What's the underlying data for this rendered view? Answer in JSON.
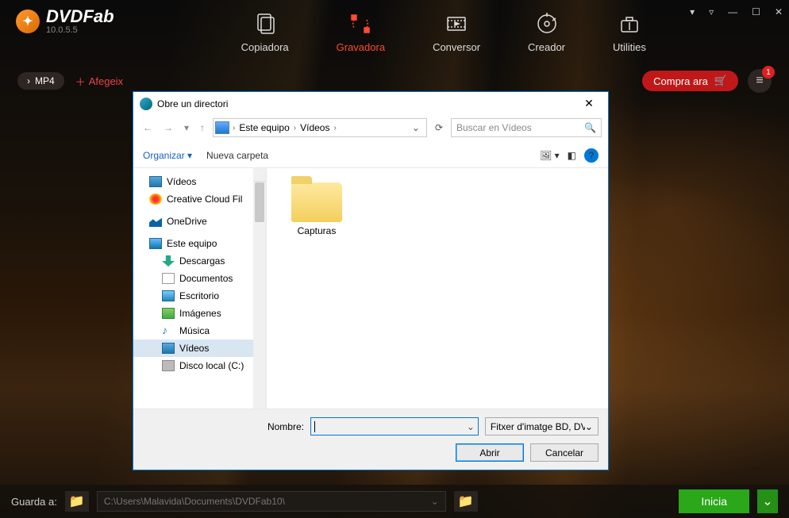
{
  "app": {
    "name": "DVDFab",
    "version": "10.0.5.5"
  },
  "tabs": {
    "copy": "Copiadora",
    "rip": "Gravadora",
    "convert": "Conversor",
    "create": "Creador",
    "util": "Utilities"
  },
  "toolbar": {
    "format_chip": "MP4",
    "add_label": "Afegeix",
    "buy_label": "Compra ara",
    "badge": "1"
  },
  "footer": {
    "save_label": "Guarda a:",
    "path": "C:\\Users\\Malavida\\Documents\\DVDFab10\\",
    "start_label": "Inicia"
  },
  "dialog": {
    "title": "Obre un directori",
    "breadcrumb": {
      "root": "Este equipo",
      "folder": "Vídeos"
    },
    "search_placeholder": "Buscar en Vídeos",
    "organize": "Organizar",
    "new_folder": "Nueva carpeta",
    "tree": {
      "videos": "Vídeos",
      "cc": "Creative Cloud Fil",
      "onedrive": "OneDrive",
      "pc": "Este equipo",
      "downloads": "Descargas",
      "documents": "Documentos",
      "desktop": "Escritorio",
      "images": "Imágenes",
      "music": "Música",
      "videos2": "Vídeos",
      "disk": "Disco local (C:)"
    },
    "content": {
      "folder1": "Capturas"
    },
    "name_label": "Nombre:",
    "filter": "Fitxer d'imatge BD, DVD ( *.ini *",
    "open_btn": "Abrir",
    "cancel_btn": "Cancelar"
  }
}
